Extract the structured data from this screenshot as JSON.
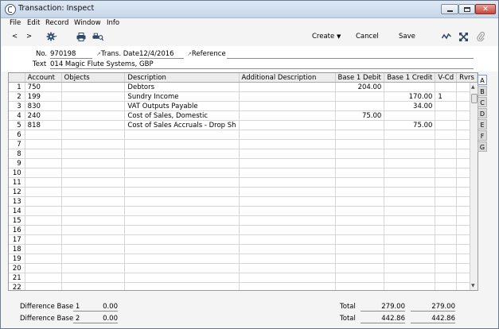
{
  "window": {
    "title": "Transaction: Inspect"
  },
  "menu": [
    "File",
    "Edit",
    "Record",
    "Window",
    "Info"
  ],
  "toolbar": {
    "prev": "<",
    "next": ">",
    "create": "Create",
    "cancel": "Cancel",
    "save": "Save"
  },
  "header": {
    "no_label": "No.",
    "no_value": "970198",
    "date_label": "Trans. Date",
    "date_value": "12/4/2016",
    "ref_label": "Reference",
    "ref_value": "",
    "text_label": "Text",
    "text_value": "014 Magic Flute Systems, GBP"
  },
  "grid": {
    "columns": [
      "",
      "Account",
      "Objects",
      "Description",
      "Additional Description",
      "Base 1 Debit",
      "Base 1 Credit",
      "V-Cd",
      "Rvrs"
    ],
    "rows": [
      [
        "1",
        "750",
        "",
        "Debtors",
        "",
        "204.00",
        "",
        "",
        ""
      ],
      [
        "2",
        "199",
        "",
        "Sundry Income",
        "",
        "",
        "170.00",
        "1",
        ""
      ],
      [
        "3",
        "830",
        "",
        "VAT Outputs Payable",
        "",
        "",
        "34.00",
        "",
        ""
      ],
      [
        "4",
        "240",
        "",
        "Cost of Sales, Domestic",
        "",
        "75.00",
        "",
        "",
        ""
      ],
      [
        "5",
        "818",
        "",
        "Cost of Sales Accruals - Drop Sh",
        "",
        "",
        "75.00",
        "",
        ""
      ],
      [
        "6",
        "",
        "",
        "",
        "",
        "",
        "",
        "",
        ""
      ],
      [
        "7",
        "",
        "",
        "",
        "",
        "",
        "",
        "",
        ""
      ],
      [
        "8",
        "",
        "",
        "",
        "",
        "",
        "",
        "",
        ""
      ],
      [
        "9",
        "",
        "",
        "",
        "",
        "",
        "",
        "",
        ""
      ],
      [
        "10",
        "",
        "",
        "",
        "",
        "",
        "",
        "",
        ""
      ],
      [
        "11",
        "",
        "",
        "",
        "",
        "",
        "",
        "",
        ""
      ],
      [
        "12",
        "",
        "",
        "",
        "",
        "",
        "",
        "",
        ""
      ],
      [
        "13",
        "",
        "",
        "",
        "",
        "",
        "",
        "",
        ""
      ],
      [
        "14",
        "",
        "",
        "",
        "",
        "",
        "",
        "",
        ""
      ],
      [
        "15",
        "",
        "",
        "",
        "",
        "",
        "",
        "",
        ""
      ],
      [
        "16",
        "",
        "",
        "",
        "",
        "",
        "",
        "",
        ""
      ],
      [
        "17",
        "",
        "",
        "",
        "",
        "",
        "",
        "",
        ""
      ],
      [
        "18",
        "",
        "",
        "",
        "",
        "",
        "",
        "",
        ""
      ],
      [
        "19",
        "",
        "",
        "",
        "",
        "",
        "",
        "",
        ""
      ],
      [
        "20",
        "",
        "",
        "",
        "",
        "",
        "",
        "",
        ""
      ],
      [
        "21",
        "",
        "",
        "",
        "",
        "",
        "",
        "",
        ""
      ],
      [
        "22",
        "",
        "",
        "",
        "",
        "",
        "",
        "",
        ""
      ]
    ]
  },
  "tabs": [
    "A",
    "B",
    "C",
    "D",
    "E",
    "F",
    "G"
  ],
  "footer": {
    "diff1_label": "Difference Base 1",
    "diff1_value": "0.00",
    "diff2_label": "Difference Base 2",
    "diff2_value": "0.00",
    "total1_label": "Total",
    "total1_debit": "279.00",
    "total1_credit": "279.00",
    "total2_label": "Total",
    "total2_debit": "442.86",
    "total2_credit": "442.86"
  }
}
